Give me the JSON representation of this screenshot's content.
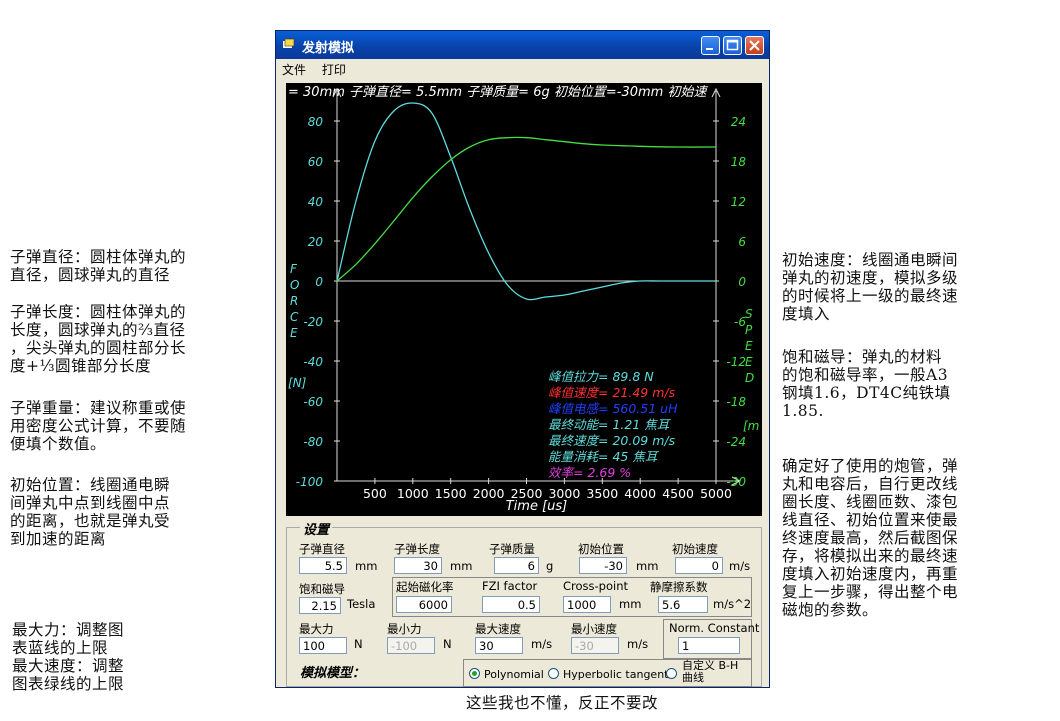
{
  "notes": {
    "bullet_diameter": "子弹直径：圆柱体弹丸的\n直径，圆球弹丸的直径",
    "bullet_length": "子弹长度：圆柱体弹丸的\n长度，圆球弹丸的⅔直径\n，尖头弹丸的圆柱部分长\n度+⅓圆锥部分长度",
    "bullet_weight": "子弹重量：建议称重或使\n用密度公式计算，不要随\n便填个数值。",
    "initial_position": "初始位置：线圈通电瞬\n间弹丸中点到线圈中点\n的距离，也就是弹丸受\n到加速的距离",
    "max_force": "最大力：调整图\n表蓝线的上限\n最大速度：调整\n图表绿线的上限",
    "initial_speed": "初始速度：线圈通电瞬间\n弹丸的初速度，模拟多级\n的时候将上一级的最终速\n度填入",
    "saturation": "饱和磁导：弹丸的材料\n的饱和磁导率，一般A3\n钢填1.6，DT4C纯铁填\n1.85.",
    "procedure": "确定好了使用的炮管，弹\n丸和电容后，自行更改线\n圈长度、线圈匝数、漆包\n线直径、初始位置来使最\n终速度最高，然后截图保\n存，将模拟出来的最终速\n度填入初始速度内，再重\n复上一步骤，得出整个电\n磁炮的参数。",
    "bottom": "这些我也不懂，反正不要改"
  },
  "window": {
    "title": "发射模拟",
    "menu": [
      "文件",
      "打印"
    ]
  },
  "plot": {
    "header": "= 30mm  子弹直径= 5.5mm  子弹质量= 6g  初始位置=-30mm  初始速",
    "force_label_letters": [
      "F",
      "O",
      "R",
      "C",
      "E"
    ],
    "force_unit": "[N]",
    "speed_label_letters": [
      "S",
      "P",
      "E",
      "E",
      "D"
    ],
    "speed_unit": "[m",
    "x_label": "Time [us]",
    "stats": [
      {
        "text": "峰值拉力= 89.8 N",
        "color": "#5fdcdc"
      },
      {
        "text": "峰值速度= 21.49 m/s",
        "color": "#ff3030"
      },
      {
        "text": "峰值电感= 560.51 uH",
        "color": "#2040ff"
      },
      {
        "text": "最终动能= 1.21 焦耳",
        "color": "#5fdcdc"
      },
      {
        "text": "最终速度= 20.09 m/s",
        "color": "#5fdcdc"
      },
      {
        "text": "能量消耗= 45 焦耳",
        "color": "#5fdcdc"
      },
      {
        "text": "效率= 2.69 %",
        "color": "#e040e0"
      }
    ]
  },
  "chart_data": {
    "type": "line",
    "xlabel": "Time [us]",
    "x_ticks": [
      500,
      1000,
      1500,
      2000,
      2500,
      3000,
      3500,
      4000,
      4500,
      5000
    ],
    "xlim": [
      0,
      5000
    ],
    "y_left": {
      "label": "FORCE [N]",
      "ticks": [
        80,
        60,
        40,
        20,
        0,
        -20,
        -40,
        -60,
        -80,
        -100
      ],
      "lim": [
        -100,
        90
      ]
    },
    "y_right": {
      "label": "SPEED [m/s]",
      "ticks": [
        24,
        18,
        12,
        6,
        0,
        -6,
        -12,
        -18,
        -24,
        -30
      ],
      "lim": [
        -30,
        27
      ]
    },
    "series": [
      {
        "color": "#5fdcdc",
        "axis": "left",
        "x": [
          0,
          250,
          500,
          750,
          1000,
          1250,
          1500,
          1750,
          2000,
          2250,
          2500,
          2750,
          3000,
          3250,
          3500,
          3750,
          4000,
          4250,
          4500,
          5000
        ],
        "y": [
          0,
          40,
          70,
          85,
          89,
          84,
          62,
          36,
          14,
          -2,
          -9,
          -8,
          -7,
          -5,
          -3,
          -1,
          0,
          0,
          0,
          0
        ]
      },
      {
        "color": "#44dd44",
        "axis": "right",
        "x": [
          0,
          250,
          500,
          750,
          1000,
          1250,
          1500,
          1750,
          2000,
          2250,
          2500,
          2750,
          3000,
          3250,
          3500,
          3750,
          4000,
          4500,
          5000
        ],
        "y": [
          0,
          2.5,
          5.6,
          9,
          12.5,
          15.6,
          18.2,
          20.1,
          21.2,
          21.5,
          21.5,
          21.2,
          20.9,
          20.6,
          20.4,
          20.3,
          20.2,
          20.1,
          20.1
        ]
      }
    ]
  },
  "settings": {
    "title": "设置",
    "bullet_diameter": {
      "label": "子弹直径",
      "value": "5.5",
      "unit": "mm"
    },
    "bullet_length": {
      "label": "子弹长度",
      "value": "30",
      "unit": "mm"
    },
    "bullet_mass": {
      "label": "子弹质量",
      "value": "6",
      "unit": "g"
    },
    "initial_position": {
      "label": "初始位置",
      "value": "-30",
      "unit": "mm"
    },
    "initial_speed": {
      "label": "初始速度",
      "value": "0",
      "unit": "m/s"
    },
    "saturation": {
      "label": "饱和磁导",
      "value": "2.15",
      "unit": "Tesla"
    },
    "start_mag": {
      "label": "起始磁化率",
      "value": "6000"
    },
    "fzi": {
      "label": "FZI factor",
      "value": "0.5"
    },
    "cross_point": {
      "label": "Cross-point",
      "value": "1000",
      "unit": "mm"
    },
    "static_friction": {
      "label": "静摩擦系数",
      "value": "5.6",
      "unit": "m/s^2"
    },
    "max_force": {
      "label": "最大力",
      "value": "100",
      "unit": "N"
    },
    "min_force": {
      "label": "最小力",
      "value": "-100",
      "unit": "N"
    },
    "max_speed": {
      "label": "最大速度",
      "value": "30",
      "unit": "m/s"
    },
    "min_speed": {
      "label": "最小速度",
      "value": "-30",
      "unit": "m/s"
    },
    "norm_constant": {
      "label": "Norm. Constant",
      "value": "1"
    },
    "model_label": "模拟模型：",
    "models": [
      "Polynomial",
      "Hyperbolic tangent",
      "自定义 B-H\n曲线"
    ],
    "selected_model": "Polynomial"
  }
}
